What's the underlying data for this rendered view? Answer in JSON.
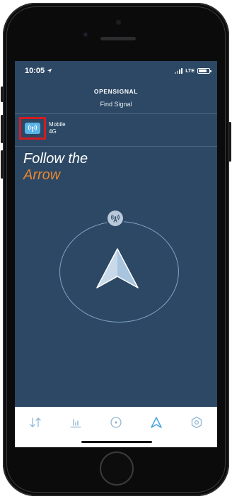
{
  "status_bar": {
    "time": "10:05",
    "network": "LTE",
    "battery_level": 0.8
  },
  "header": {
    "brand": "OPENSIGNAL",
    "title": "Find Signal"
  },
  "network": {
    "type": "Mobile",
    "generation": "4G"
  },
  "headline": {
    "line1": "Follow the",
    "line2": "Arrow"
  },
  "tab_bar": {
    "items": [
      {
        "icon": "speed-test-icon",
        "selected": false
      },
      {
        "icon": "stats-icon",
        "selected": false
      },
      {
        "icon": "map-pin-icon",
        "selected": false
      },
      {
        "icon": "arrow-navigation-icon",
        "selected": true
      },
      {
        "icon": "settings-hexagon-icon",
        "selected": false
      }
    ]
  },
  "colors": {
    "screen_bg": "#2c4864",
    "accent_orange": "#e98731",
    "highlight_red": "#d21d24",
    "icon_blue": "#58b4e6",
    "tab_icon": "#8fb6d6"
  }
}
